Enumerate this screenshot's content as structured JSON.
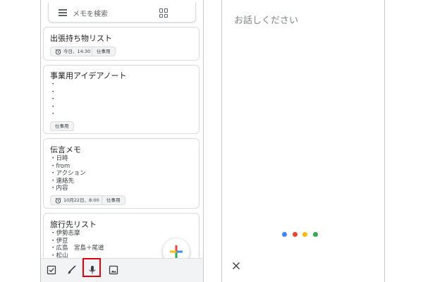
{
  "search": {
    "placeholder": "メモを検索"
  },
  "notes": [
    {
      "title": "出張持ち物リスト",
      "lines": [],
      "reminder": "今日、14:30",
      "label": "仕事用"
    },
    {
      "title": "事業用アイデアノート",
      "lines": [
        "・",
        "・",
        "・",
        "・",
        "・"
      ],
      "reminder": "",
      "label": "仕事用"
    },
    {
      "title": "伝言メモ",
      "lines": [
        "・日時",
        "・from",
        "・アクション",
        "・連絡先",
        "・内容"
      ],
      "reminder": "10月22日、8:00",
      "label": "仕事用"
    },
    {
      "title": "旅行先リスト",
      "lines": [
        "・伊勢志摩",
        "・伊豆",
        "・広島　宮島＋尾道",
        "・松山"
      ],
      "reminder": "",
      "label": ""
    }
  ],
  "bottom_bar": {
    "icons": [
      "checkbox-icon",
      "brush-icon",
      "mic-icon",
      "image-icon"
    ],
    "highlight_color": "#e60012"
  },
  "fab": {
    "icon": "add-icon",
    "colors": [
      "#4285f4",
      "#ea4335",
      "#fbbc05",
      "#34a853"
    ]
  },
  "voice": {
    "prompt": "お話しください",
    "dot_colors": [
      "#4285f4",
      "#ea4335",
      "#fbbc05",
      "#34a853"
    ],
    "close_icon": "close-icon"
  }
}
